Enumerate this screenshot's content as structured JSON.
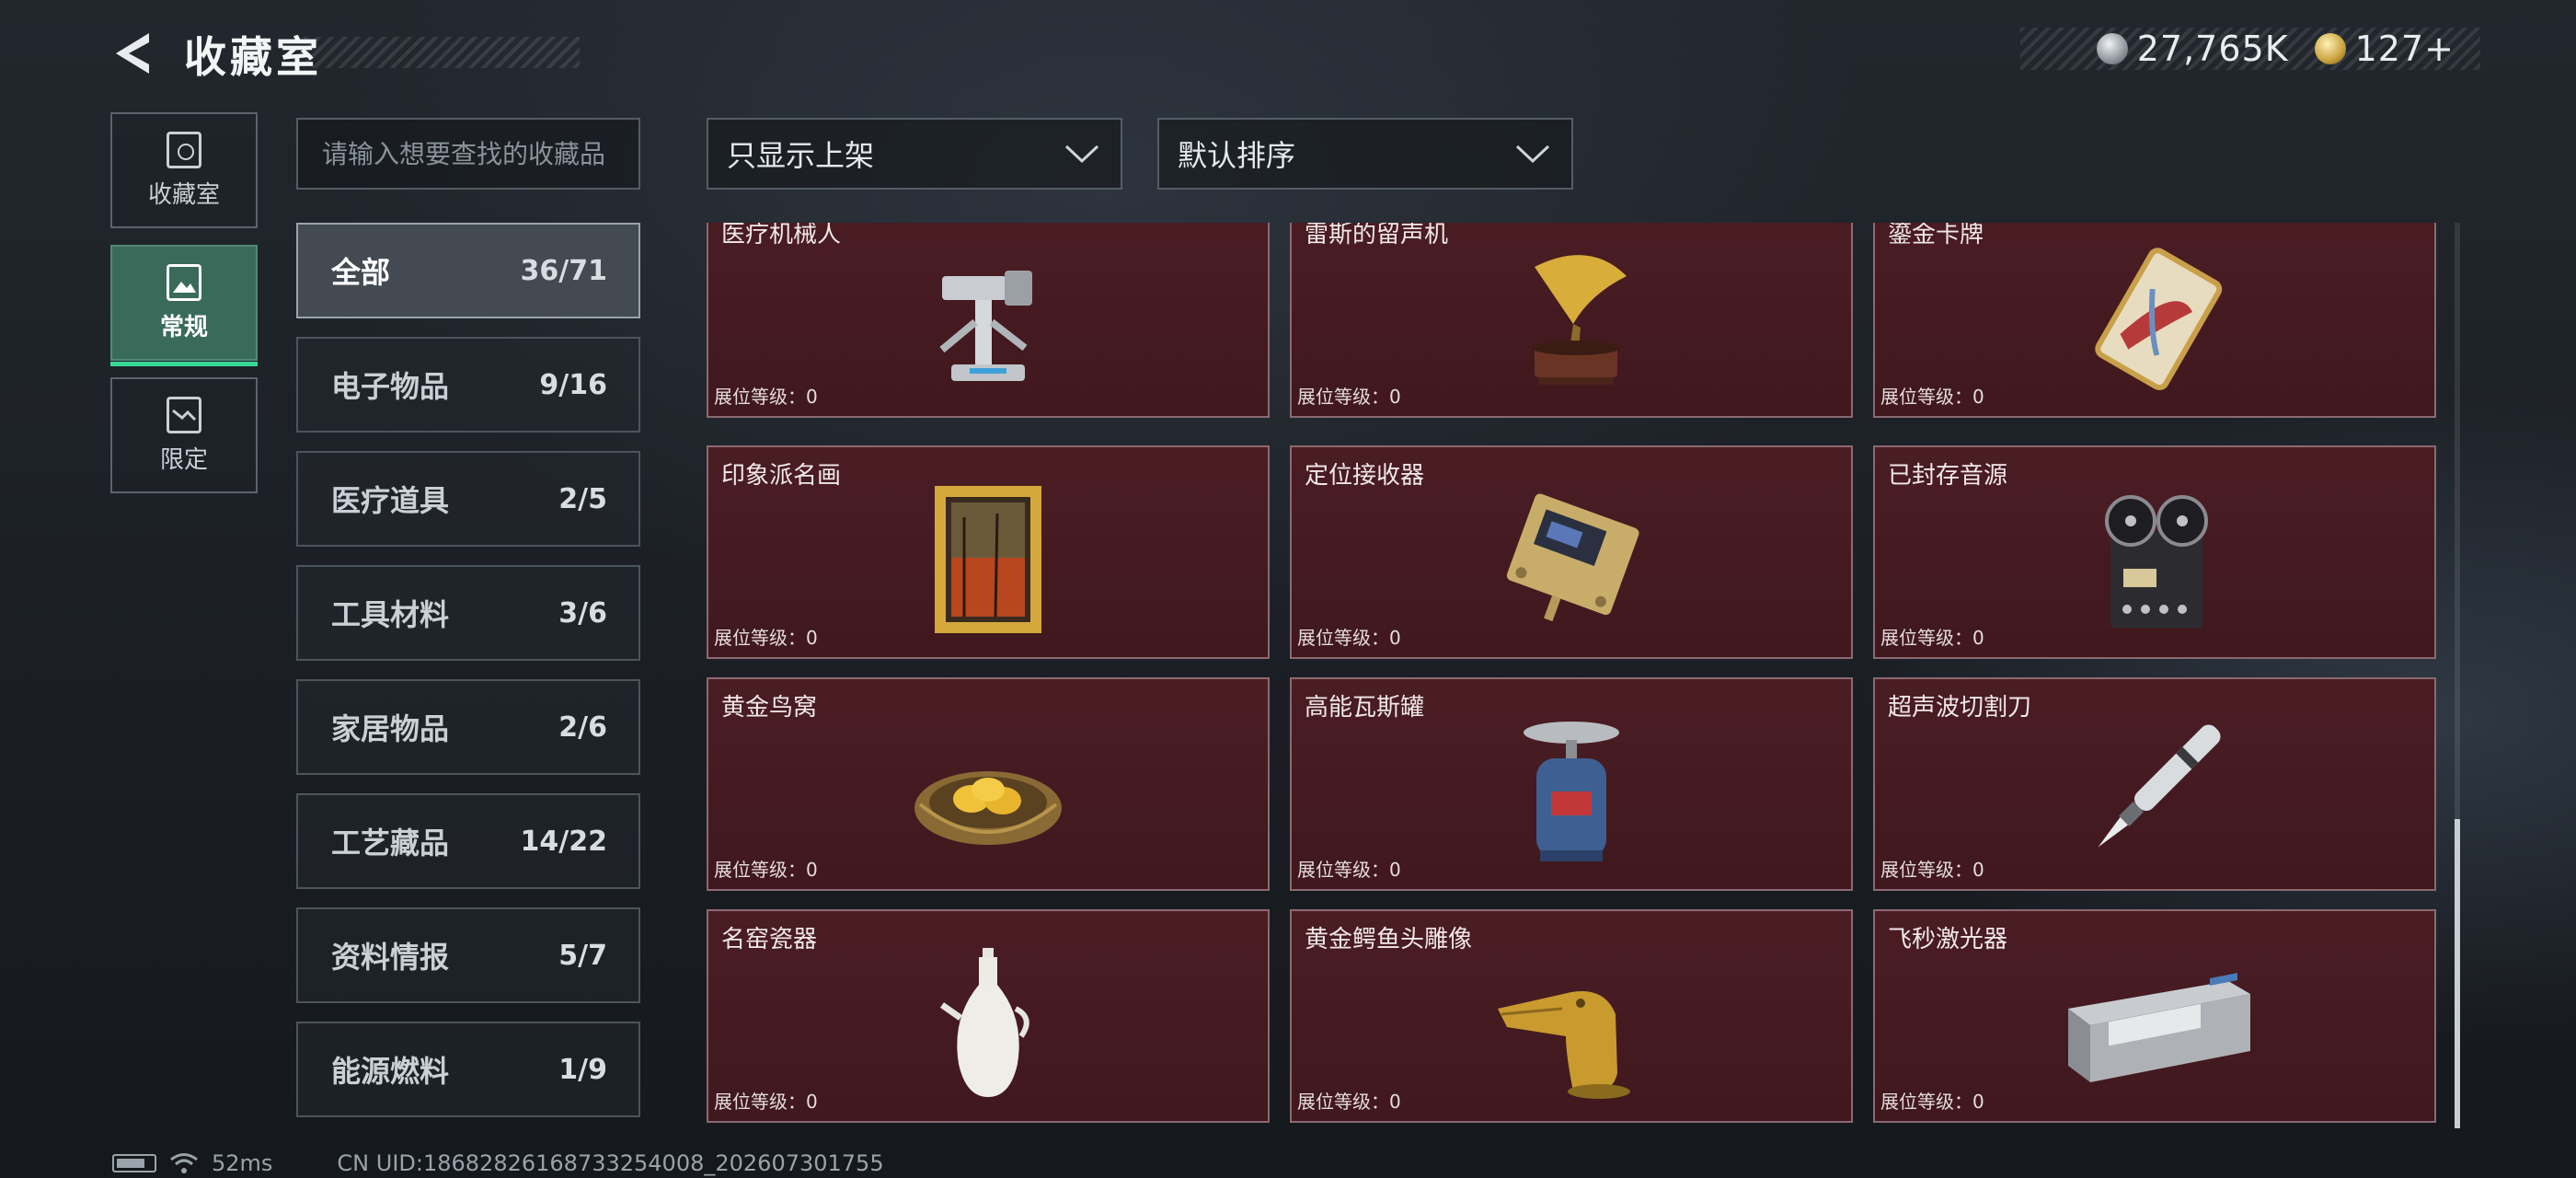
{
  "header": {
    "title": "收藏室",
    "currency": [
      {
        "icon": "silver-coin-icon",
        "value": "27,765K"
      },
      {
        "icon": "gold-coin-icon",
        "value": "127+"
      }
    ]
  },
  "modes": [
    {
      "label": "收藏室",
      "icon": "cabinet-icon"
    },
    {
      "label": "常规",
      "icon": "regular-collection-icon",
      "active": true
    },
    {
      "label": "限定",
      "icon": "limited-collection-icon"
    }
  ],
  "search": {
    "placeholder": "请输入想要查找的收藏品"
  },
  "filters": {
    "shelf": "只显示上架",
    "sort": "默认排序"
  },
  "categories": [
    {
      "name": "全部",
      "count": "36/71",
      "active": true
    },
    {
      "name": "电子物品",
      "count": "9/16"
    },
    {
      "name": "医疗道具",
      "count": "2/5"
    },
    {
      "name": "工具材料",
      "count": "3/6"
    },
    {
      "name": "家居物品",
      "count": "2/6"
    },
    {
      "name": "工艺藏品",
      "count": "14/22"
    },
    {
      "name": "资料情报",
      "count": "5/7"
    },
    {
      "name": "能源燃料",
      "count": "1/9"
    }
  ],
  "items": [
    {
      "name": "医疗机械人",
      "level": "展位等级：0",
      "icon": "medical-robot-icon"
    },
    {
      "name": "雷斯的留声机",
      "level": "展位等级：0",
      "icon": "gramophone-icon"
    },
    {
      "name": "鎏金卡牌",
      "level": "展位等级：0",
      "icon": "gilded-card-icon"
    },
    {
      "name": "印象派名画",
      "level": "展位等级：0",
      "icon": "painting-icon"
    },
    {
      "name": "定位接收器",
      "level": "展位等级：0",
      "icon": "receiver-icon"
    },
    {
      "name": "已封存音源",
      "level": "展位等级：0",
      "icon": "reel-recorder-icon"
    },
    {
      "name": "黄金鸟窝",
      "level": "展位等级：0",
      "icon": "golden-nest-icon"
    },
    {
      "name": "高能瓦斯罐",
      "level": "展位等级：0",
      "icon": "gas-canister-icon"
    },
    {
      "name": "超声波切割刀",
      "level": "展位等级：0",
      "icon": "ultrasonic-knife-icon"
    },
    {
      "name": "名窑瓷器",
      "level": "展位等级：0",
      "icon": "porcelain-vase-icon"
    },
    {
      "name": "黄金鳄鱼头雕像",
      "level": "展位等级：0",
      "icon": "crocodile-statue-icon"
    },
    {
      "name": "飞秒激光器",
      "level": "展位等级：0",
      "icon": "femtosecond-laser-icon"
    }
  ],
  "footer": {
    "ping": "52ms",
    "uid": "CN UID:18682826168733254008_202607301755"
  },
  "colors": {
    "accent": "#36d896",
    "card_bg": "#44191f",
    "card_border": "#8a6a70",
    "active_mode": "#3a6a5a"
  }
}
